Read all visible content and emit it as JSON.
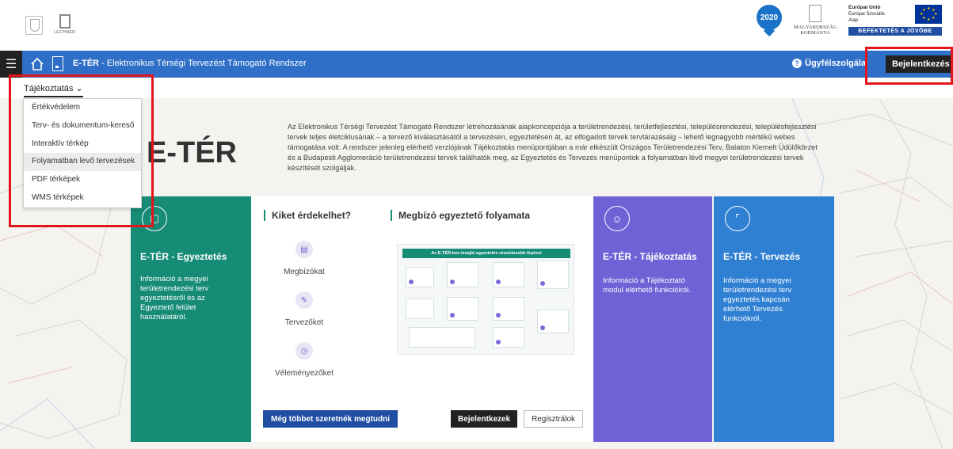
{
  "logos": {
    "lechner_text": "LECHNER",
    "badge_text": "2020",
    "gov_text": "MAGYARORSZÁG KORMÁNYA",
    "eu_line1": "Európai Unió",
    "eu_line2": "Európai Szociális",
    "eu_line3": "Alap",
    "eu_banner": "BEFEKTETÉS A JÖVŐBE"
  },
  "navbar": {
    "title_bold": "E-TÉR",
    "title_rest": " - Elektronikus Térségi Tervezést Támogató Rendszer",
    "help_label": "Ügyfélszolgála",
    "login_label": "Bejelentkezés"
  },
  "subnav": {
    "label": "Tájékoztatás",
    "chevron": "⌄"
  },
  "dropdown": {
    "items": [
      "Értékvédelem",
      "Terv- és dokumentum-kereső",
      "Interaktív térkép",
      "Folyamatban levő tervezések",
      "PDF térképek",
      "WMS térképek"
    ],
    "active_index": 3
  },
  "hero": {
    "title": "E-TÉR",
    "intro": "Az Elektronikus Térségi Tervezést Támogató Rendszer létrehozásának alapkoncepciója a területrendezési, területfejlesztési, településrendezési, településfejlesztési tervek teljes életciklusának – a tervező kiválasztásától a tervezésen, egyeztetésen át, az elfogadott tervek tervtárazásáig – lehető legnagyobb mértékű webes támogatása volt. A rendszer jelenleg elérhető verziójának Tájékoztatás menüpontjában a már elkészült Országos Területrendezési Terv, Balaton Kiemelt Üdülőkörzet és a Budapesti Agglomeráció területrendezési tervek találhatók meg, az Egyeztetés és Tervezés menüpontok a folyamatban lévő megyei területrendezési tervek készítését szolgálják."
  },
  "card_egyeztetes": {
    "title": "E-TÉR - Egyeztetés",
    "text": "Információ a megyei területrendezési terv egyeztetésről és az Egyeztető felület használatáról.",
    "icon": "chat-icon"
  },
  "panel": {
    "audience_heading": "Kiket érdekelhet?",
    "process_heading": "Megbízó egyeztető folyamata",
    "audiences": [
      "Megbízókat",
      "Tervezőket",
      "Véleményezőket"
    ],
    "diagram_title": "Az E-TÉR-ben lezajló egyeztetés részletesebb lépései",
    "more_button": "Még többet szeretnék megtudni",
    "login_button": "Bejelentkezek",
    "register_button": "Regisztrálok"
  },
  "card_tajekoztatas": {
    "title": "E-TÉR - Tájékoztatás",
    "text": "Információ a Tájékoztató modul elérhető funkcióiról.",
    "icon": "users-icon"
  },
  "card_tervezes": {
    "title": "E-TÉR - Tervezés",
    "text": "Információ a megyei területrendezési terv egyeztetés kapcsán elérhető Tervezés funkciókról.",
    "icon": "frame-icon"
  },
  "colors": {
    "nav_blue": "#2f6fc8",
    "green": "#168b75",
    "purple": "#6f62d6",
    "blue": "#2f7fd3",
    "highlight_red": "#e3141b"
  }
}
